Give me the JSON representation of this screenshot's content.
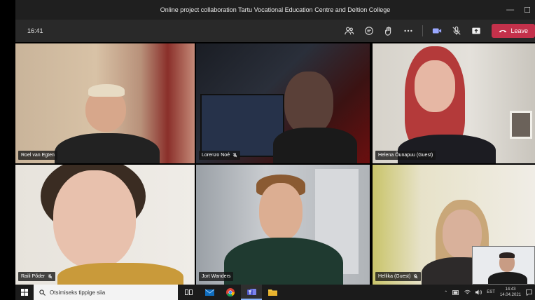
{
  "window": {
    "title": "Online project collaboration Tartu Vocational Education Centre and Deltion College"
  },
  "toolbar": {
    "time": "16:41",
    "leave_label": "Leave"
  },
  "participants": [
    {
      "name": "Roel van Egten",
      "muted": false
    },
    {
      "name": "Lorenzo Noé",
      "muted": true
    },
    {
      "name": "Helena Õunapuu (Guest)",
      "muted": false
    },
    {
      "name": "Raili Põder",
      "muted": true
    },
    {
      "name": "Jort Wanders",
      "muted": false
    },
    {
      "name": "Hellika (Guest)",
      "muted": true
    }
  ],
  "taskbar": {
    "search_placeholder": "Otsimiseks tippige siia",
    "language": "EST",
    "clock_time": "14:43",
    "clock_date": "14.04.2021"
  },
  "colors": {
    "leave": "#c4314b",
    "titlebar": "#1f1f1f",
    "toolbar": "#292929"
  }
}
